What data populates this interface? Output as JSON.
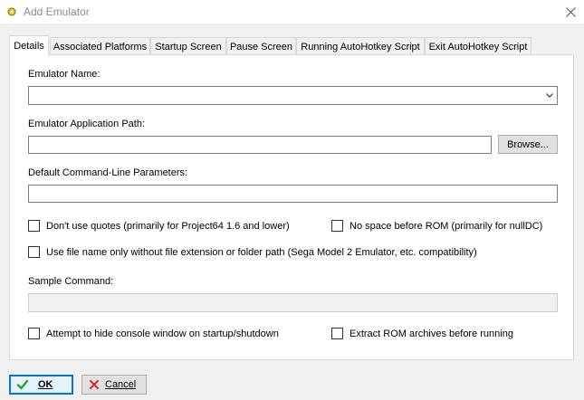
{
  "window": {
    "title": "Add Emulator",
    "icon": "app-icon",
    "close_icon": "close-icon"
  },
  "tabs": [
    {
      "label": "Details",
      "active": true
    },
    {
      "label": "Associated Platforms",
      "active": false
    },
    {
      "label": "Startup Screen",
      "active": false
    },
    {
      "label": "Pause Screen",
      "active": false
    },
    {
      "label": "Running AutoHotkey Script",
      "active": false
    },
    {
      "label": "Exit AutoHotkey Script",
      "active": false
    }
  ],
  "details": {
    "emulator_name_label": "Emulator Name:",
    "emulator_name_value": "",
    "app_path_label": "Emulator Application Path:",
    "app_path_value": "",
    "browse_label": "Browse...",
    "cmdline_label": "Default Command-Line Parameters:",
    "cmdline_value": "",
    "no_quotes_label": "Don't use quotes (primarily for Project64 1.6 and lower)",
    "no_space_label": "No space before ROM (primarily for nullDC)",
    "file_name_only_label": "Use file name only without file extension or folder path (Sega Model 2 Emulator, etc. compatibility)",
    "sample_command_label": "Sample Command:",
    "sample_command_value": "",
    "hide_console_label": "Attempt to hide console window on startup/shutdown",
    "extract_rom_label": "Extract ROM archives before running",
    "checks": {
      "no_quotes": false,
      "no_space": false,
      "file_name_only": false,
      "hide_console": false,
      "extract_rom": false
    }
  },
  "footer": {
    "ok_label": "OK",
    "cancel_label": "Cancel"
  },
  "colors": {
    "accent": "#0078d7",
    "ok_check": "#2f9e2f",
    "cancel_x": "#d83030"
  }
}
